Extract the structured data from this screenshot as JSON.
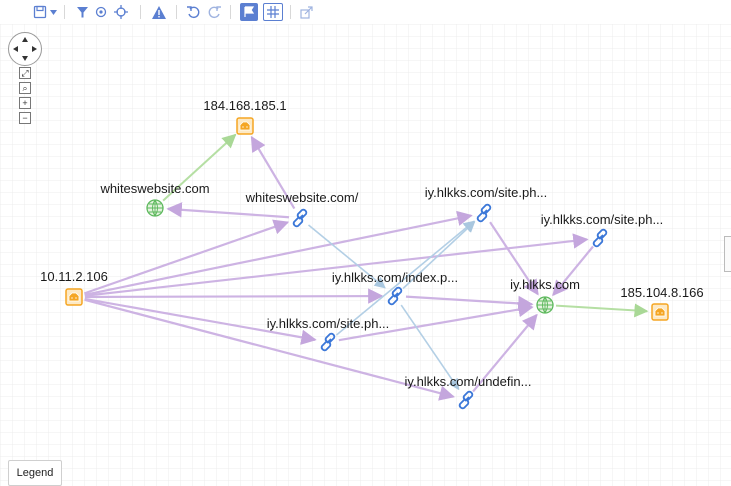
{
  "graph": {
    "nodes": [
      {
        "id": "n1",
        "label": "184.168.185.1",
        "kind": "host-icon"
      },
      {
        "id": "n2",
        "label": "whiteswebsite.com",
        "kind": "domain-icon"
      },
      {
        "id": "n3",
        "label": "whiteswebsite.com/",
        "kind": "url-link-icon"
      },
      {
        "id": "n4",
        "label": "iy.hlkks.com/site.ph...",
        "kind": "url-link-icon"
      },
      {
        "id": "n5",
        "label": "iy.hlkks.com/site.ph...",
        "kind": "url-link-icon"
      },
      {
        "id": "n6",
        "label": "10.11.2.106",
        "kind": "host-icon"
      },
      {
        "id": "n7",
        "label": "iy.hlkks.com/index.p...",
        "kind": "url-link-icon"
      },
      {
        "id": "n8",
        "label": "iy.hlkks.com",
        "kind": "domain-icon"
      },
      {
        "id": "n9",
        "label": "185.104.8.166",
        "kind": "host-icon"
      },
      {
        "id": "n10",
        "label": "iy.hlkks.com/site.ph...",
        "kind": "url-link-icon"
      },
      {
        "id": "n11",
        "label": "iy.hlkks.com/undefin...",
        "kind": "url-link-icon"
      }
    ],
    "edges": [
      {
        "from": "n2",
        "to": "n1",
        "kind": "green"
      },
      {
        "from": "n8",
        "to": "n9",
        "kind": "green"
      },
      {
        "from": "n3",
        "to": "n1",
        "kind": "purple"
      },
      {
        "from": "n3",
        "to": "n2",
        "kind": "purple"
      },
      {
        "from": "n6",
        "to": "n3",
        "kind": "purple"
      },
      {
        "from": "n6",
        "to": "n4",
        "kind": "purple"
      },
      {
        "from": "n6",
        "to": "n5",
        "kind": "purple"
      },
      {
        "from": "n6",
        "to": "n7",
        "kind": "purple"
      },
      {
        "from": "n6",
        "to": "n10",
        "kind": "purple"
      },
      {
        "from": "n6",
        "to": "n11",
        "kind": "purple"
      },
      {
        "from": "n7",
        "to": "n8",
        "kind": "purple"
      },
      {
        "from": "n10",
        "to": "n8",
        "kind": "purple"
      },
      {
        "from": "n4",
        "to": "n8",
        "kind": "purple"
      },
      {
        "from": "n5",
        "to": "n8",
        "kind": "purple"
      },
      {
        "from": "n11",
        "to": "n8",
        "kind": "purple"
      },
      {
        "from": "n3",
        "to": "n7",
        "kind": "blue"
      },
      {
        "from": "n7",
        "to": "n4",
        "kind": "blue"
      },
      {
        "from": "n7",
        "to": "n11",
        "kind": "blue"
      },
      {
        "from": "n10",
        "to": "n4",
        "kind": "blue"
      }
    ]
  },
  "legend": {
    "label": "Legend"
  },
  "colors": {
    "green_edge": "#b5dfa3",
    "purple_edge": "#cdb3e3",
    "blue_edge": "#b3cfe5",
    "host": "#f5a623",
    "link": "#3b77d8",
    "domain": "#5cb85c",
    "toolbar": "#5b7fd1"
  }
}
